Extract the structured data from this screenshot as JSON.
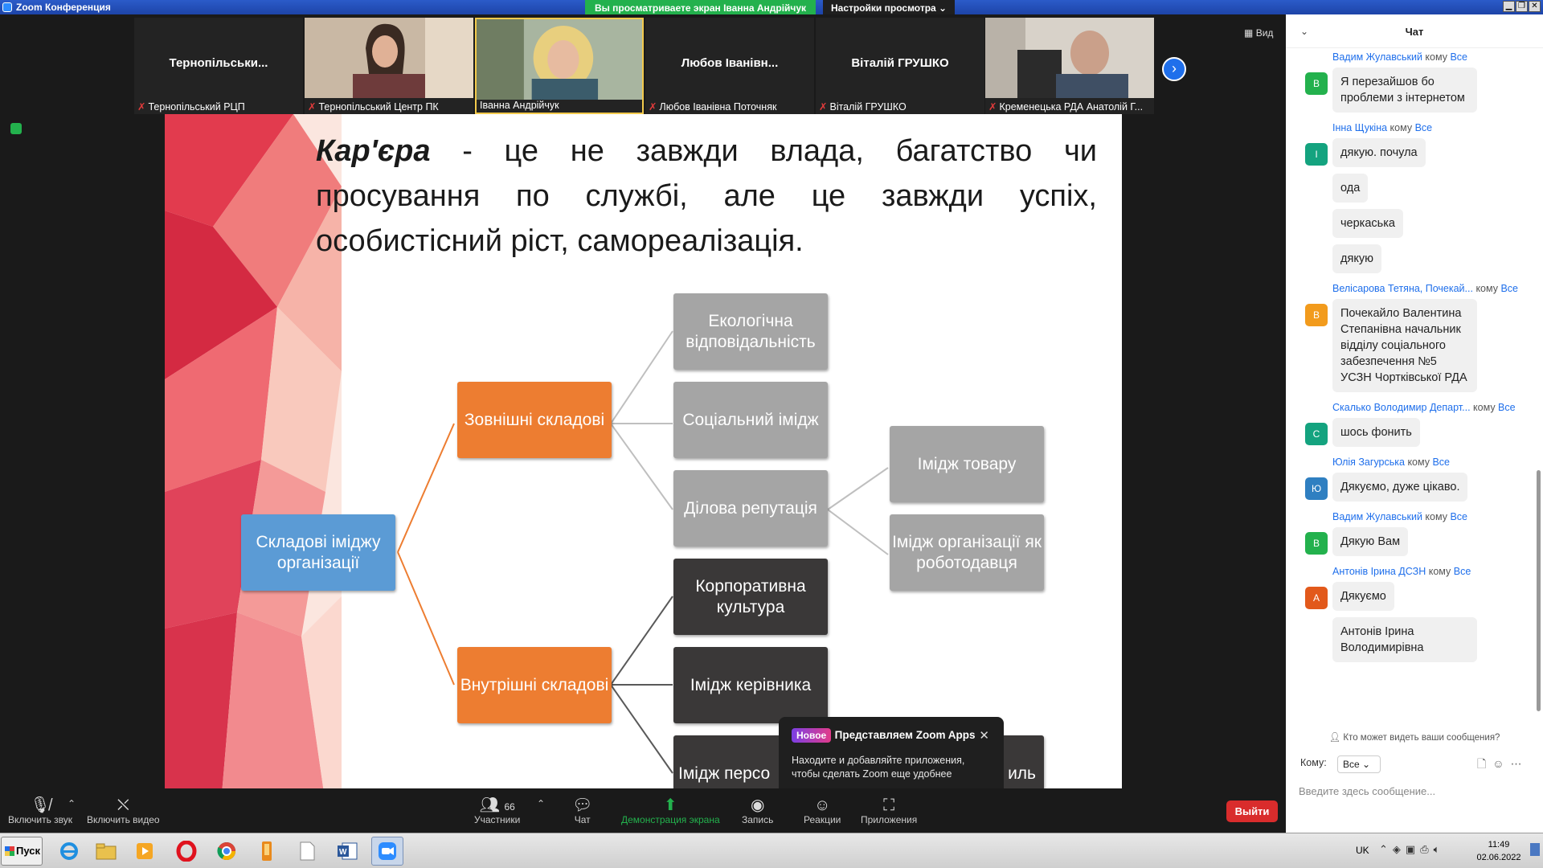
{
  "window": {
    "title": "Zoom Конференция",
    "share_banner": "Вы просматриваете экран Іванна Андрійчук",
    "view_options": "Настройки просмотра ⌄"
  },
  "participants": [
    {
      "big_name": "Тернопільськи...",
      "label": "Тернопільський РЦП",
      "muted": true,
      "video": false
    },
    {
      "big_name": "",
      "label": "Тернопільський Центр ПК",
      "muted": true,
      "video": true
    },
    {
      "big_name": "",
      "label": "Іванна Андрійчук",
      "muted": false,
      "video": true
    },
    {
      "big_name": "Любов Іванівн...",
      "label": "Любов Іванівна Поточняк",
      "muted": true,
      "video": false
    },
    {
      "big_name": "Віталій ГРУШКО",
      "label": "Віталій ГРУШКО",
      "muted": true,
      "video": false
    },
    {
      "big_name": "",
      "label": "Кременецька РДА Анатолій Г...",
      "muted": true,
      "video": true
    }
  ],
  "view_button": "Вид",
  "slide": {
    "title_keyword": "Кар'єра",
    "title_rest": " - це не завжди влада, багатство чи просування по службі, але це завжди успіх, особистісний ріст, самореалізація.",
    "root": "Складові іміджу організації",
    "external": "Зовнішні складові",
    "internal": "Внутрішні складові",
    "eco": "Екологічна відповідальність",
    "social": "Соціальний імідж",
    "reputation": "Ділова репутація",
    "product": "Імідж товару",
    "employer": "Імідж організації як роботодавця",
    "culture": "Корпоративна культура",
    "leader": "Імідж керівника",
    "staff": "Імідж персо",
    "style": "иль"
  },
  "apps_popup": {
    "badge": "Новое",
    "head": "Представляем Zoom Apps",
    "body": "Находите и добавляйте приложения, чтобы сделать Zoom еще удобнее"
  },
  "toolbar": {
    "audio": "Включить звук",
    "video": "Включить видео",
    "participants": "Участники",
    "participants_count": "66",
    "chat": "Чат",
    "share": "Демонстрация экрана",
    "record": "Запись",
    "reactions": "Реакции",
    "apps": "Приложения",
    "leave": "Выйти"
  },
  "chat": {
    "title": "Чат",
    "to_word": "кому",
    "everyone": "Все",
    "messages": [
      {
        "sender": "Вадим Жулавський",
        "initial": "В",
        "color": "#23b14d",
        "lines": [
          "Я перезайшов бо проблеми з інтернетом"
        ]
      },
      {
        "sender": "Інна Щукіна",
        "initial": "І",
        "color": "#14a37f",
        "lines": [
          "дякую. почула",
          "ода",
          "черкаська",
          "дякую"
        ]
      },
      {
        "sender": "Велісарова Тетяна, Почекай...",
        "initial": "В",
        "color": "#f29b1d",
        "lines": [
          "Почекайло Валентина Степанівна начальник відділу соціального забезпечення №5 УСЗН Чортківської РДА"
        ]
      },
      {
        "sender": "Скалько Володимир Департ...",
        "initial": "С",
        "color": "#14a37f",
        "lines": [
          "шось фонить"
        ]
      },
      {
        "sender": "Юлія Загурська",
        "initial": "Ю",
        "color": "#2f7fc1",
        "lines": [
          "Дякуємо, дуже цікаво."
        ]
      },
      {
        "sender": "Вадим Жулавський",
        "initial": "В",
        "color": "#23b14d",
        "lines": [
          "Дякую Вам"
        ]
      },
      {
        "sender": "Антонів Ірина ДСЗН",
        "initial": "А",
        "color": "#e2591b",
        "lines": [
          "Дякуємо",
          "Антонів Ірина Володимирівна"
        ]
      }
    ],
    "who_sees": "Кто может видеть ваши сообщения?",
    "to_label": "Кому:",
    "to_value": "Все",
    "input_placeholder": "Введите здесь сообщение..."
  },
  "taskbar": {
    "start": "Пуск",
    "lang": "UK",
    "time": "11:49",
    "date": "02.06.2022"
  }
}
